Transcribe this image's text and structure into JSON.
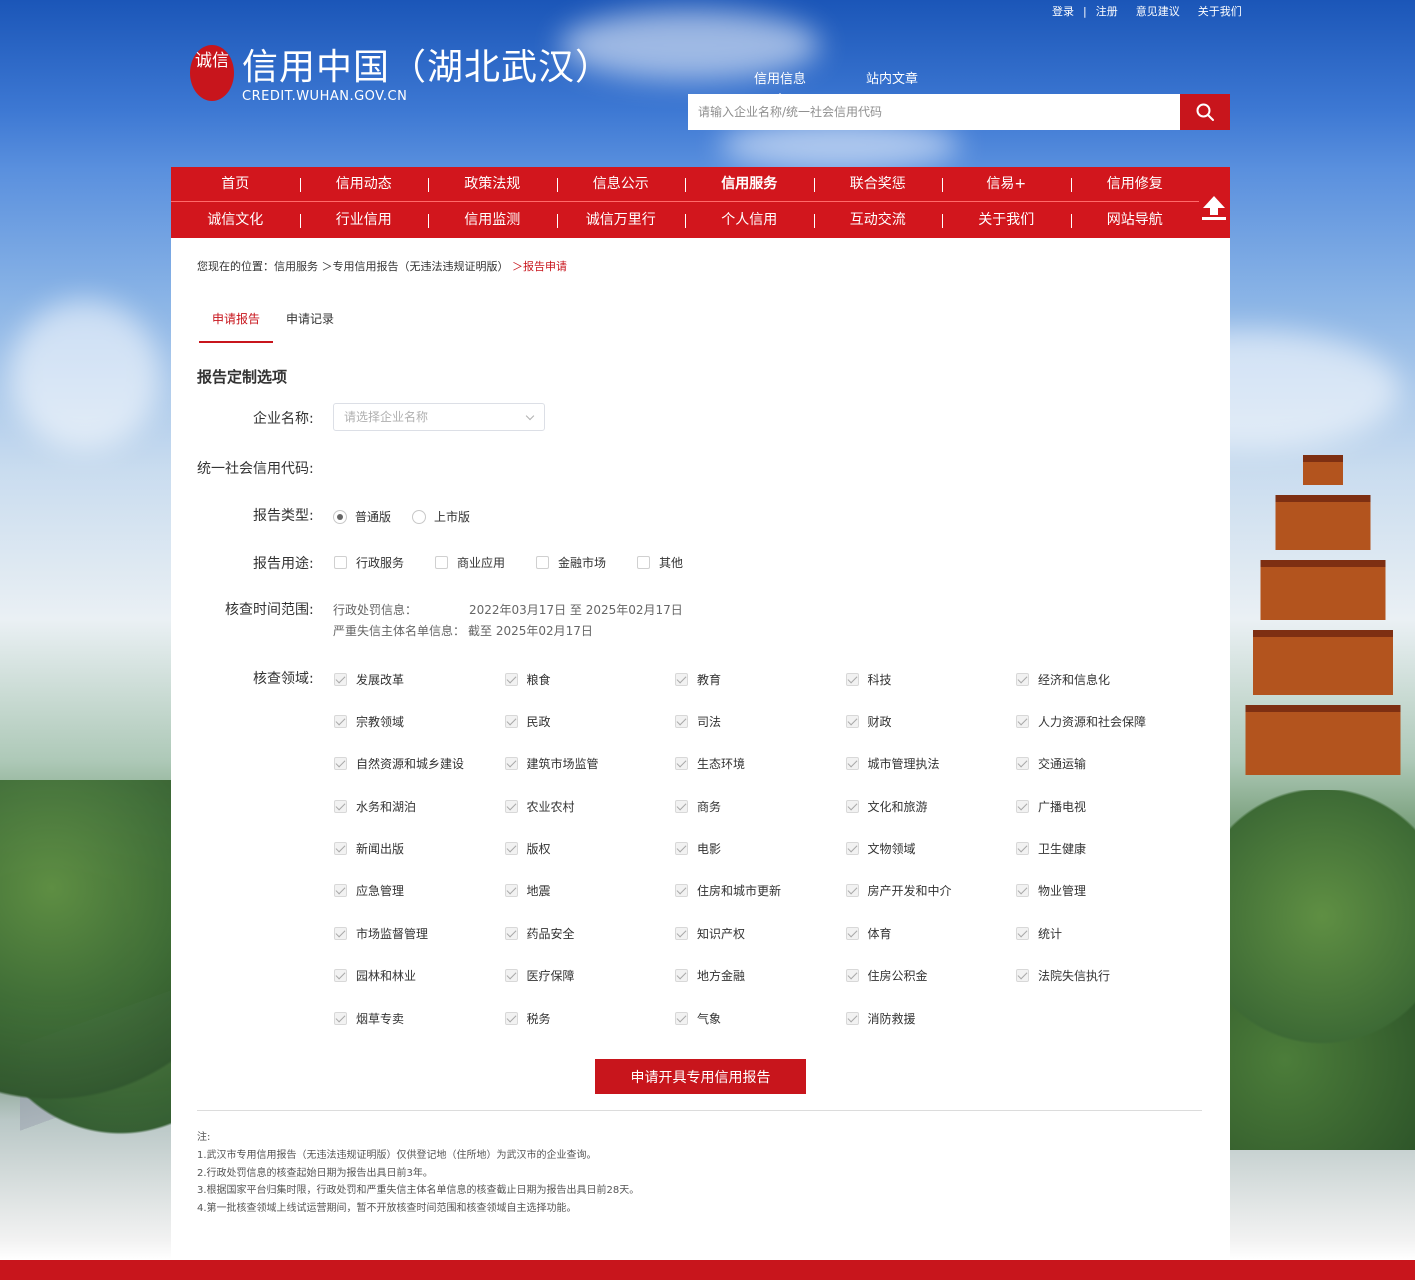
{
  "top_links": [
    "登录",
    "注册",
    "意见建议",
    "关于我们"
  ],
  "logo": {
    "seal": "诚信",
    "title": "信用中国（湖北武汉）",
    "subtitle": "CREDIT.WUHAN.GOV.CN"
  },
  "search": {
    "tabs": [
      "信用信息",
      "站内文章"
    ],
    "placeholder": "请输入企业名称/统一社会信用代码"
  },
  "nav": {
    "row1": [
      "首页",
      "信用动态",
      "政策法规",
      "信息公示",
      "信用服务",
      "联合奖惩",
      "信易+",
      "信用修复"
    ],
    "row2": [
      "诚信文化",
      "行业信用",
      "信用监测",
      "诚信万里行",
      "个人信用",
      "互动交流",
      "关于我们",
      "网站导航"
    ]
  },
  "breadcrumb": {
    "prefix": "您现在的位置：",
    "path": "信用服务 ＞专用信用报告（无违法违规证明版）",
    "current": "＞报告申请"
  },
  "tabs": [
    "申请报告",
    "申请记录"
  ],
  "form": {
    "section_title": "报告定制选项",
    "company_label": "企业名称:",
    "company_placeholder": "请选择企业名称",
    "code_label": "统一社会信用代码:",
    "type_label": "报告类型:",
    "type_options": [
      "普通版",
      "上市版"
    ],
    "usage_label": "报告用途:",
    "usage_options": [
      "行政服务",
      "商业应用",
      "金融市场",
      "其他"
    ],
    "time_label": "核查时间范围:",
    "admin_penalty_label": "行政处罚信息：",
    "admin_penalty_range": "2022年03月17日 至 2025年02月17日",
    "blacklist_label": "严重失信主体名单信息：",
    "blacklist_range": "截至 2025年02月17日",
    "domain_label": "核查领域:",
    "domains": [
      "发展改革",
      "粮食",
      "教育",
      "科技",
      "经济和信息化",
      "宗教领域",
      "民政",
      "司法",
      "财政",
      "人力资源和社会保障",
      "自然资源和城乡建设",
      "建筑市场监管",
      "生态环境",
      "城市管理执法",
      "交通运输",
      "水务和湖泊",
      "农业农村",
      "商务",
      "文化和旅游",
      "广播电视",
      "新闻出版",
      "版权",
      "电影",
      "文物领域",
      "卫生健康",
      "应急管理",
      "地震",
      "住房和城市更新",
      "房产开发和中介",
      "物业管理",
      "市场监督管理",
      "药品安全",
      "知识产权",
      "体育",
      "统计",
      "园林和林业",
      "医疗保障",
      "地方金融",
      "住房公积金",
      "法院失信执行",
      "烟草专卖",
      "税务",
      "气象",
      "消防救援"
    ],
    "submit": "申请开具专用信用报告"
  },
  "notes": [
    "注:",
    "1.武汉市专用信用报告（无违法违规证明版）仅供登记地（住所地）为武汉市的企业查询。",
    "2.行政处罚信息的核查起始日期为报告出具日前3年。",
    "3.根据国家平台归集时限，行政处罚和严重失信主体名单信息的核查截止日期为报告出具日前28天。",
    "4.第一批核查领域上线试运营期间，暂不开放核查时间范围和核查领域自主选择功能。"
  ],
  "colors": {
    "brand_red": "#c8151c",
    "nav_red": "#d2161d"
  }
}
